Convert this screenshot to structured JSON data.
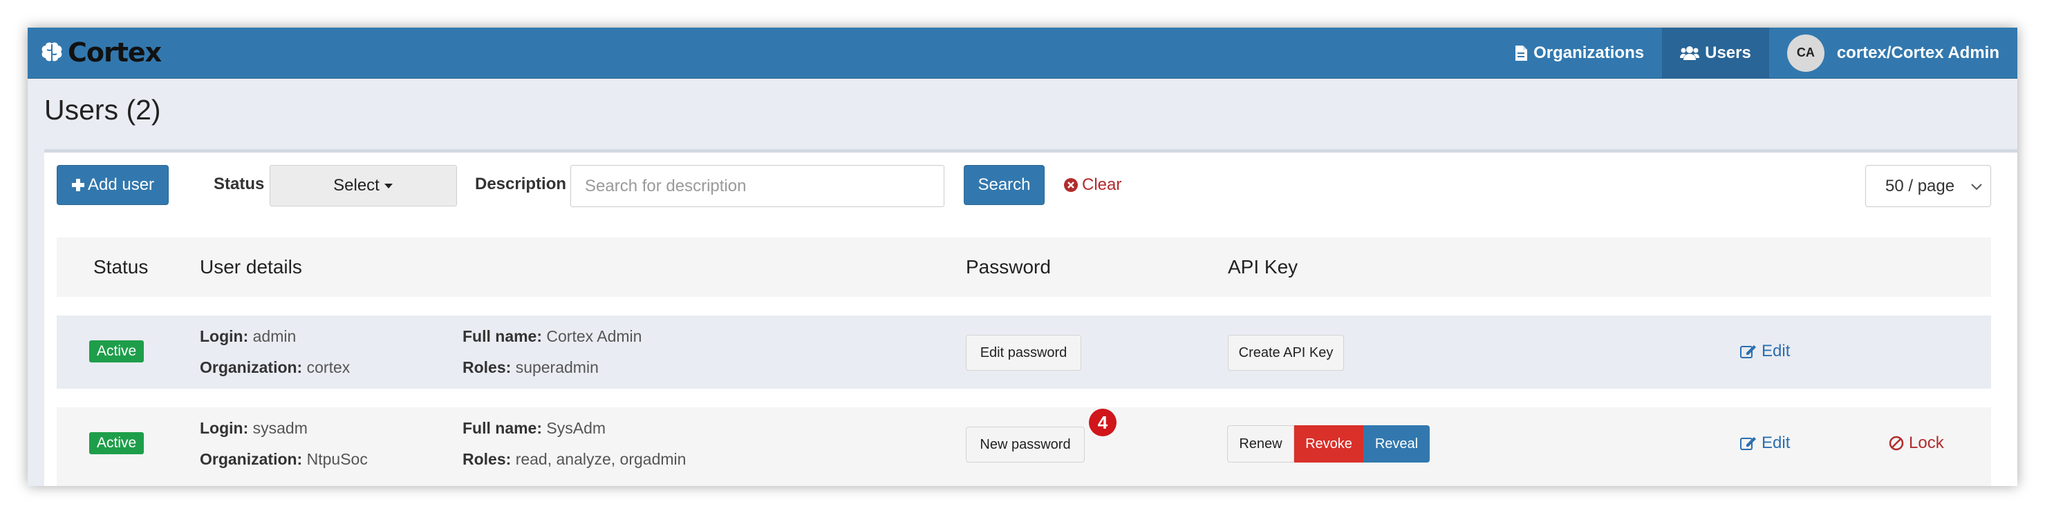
{
  "navbar": {
    "brand": "Cortex",
    "items": [
      {
        "label": "Organizations",
        "icon": "document-icon"
      },
      {
        "label": "Users",
        "icon": "users-icon",
        "active": true
      }
    ],
    "user": {
      "initials": "CA",
      "label": "cortex/Cortex Admin"
    }
  },
  "page": {
    "title": "Users (2)"
  },
  "toolbar": {
    "add_user": "Add user",
    "status_label": "Status",
    "status_value": "Select",
    "description_label": "Description",
    "description_placeholder": "Search for description",
    "search": "Search",
    "clear": "Clear",
    "per_page": "50 / page"
  },
  "table": {
    "headers": {
      "status": "Status",
      "user_details": "User details",
      "password": "Password",
      "api_key": "API Key"
    },
    "rows": [
      {
        "status": "Active",
        "login_label": "Login:",
        "login": "admin",
        "org_label": "Organization:",
        "org": "cortex",
        "fullname_label": "Full name:",
        "fullname": "Cortex Admin",
        "roles_label": "Roles:",
        "roles": "superadmin",
        "password_action": "Edit password",
        "api_action": "Create API Key",
        "edit": "Edit"
      },
      {
        "status": "Active",
        "login_label": "Login:",
        "login": "sysadm",
        "org_label": "Organization:",
        "org": "NtpuSoc",
        "fullname_label": "Full name:",
        "fullname": "SysAdm",
        "roles_label": "Roles:",
        "roles": "read, analyze, orgadmin",
        "password_action": "New password",
        "password_badge": "4",
        "api_renew": "Renew",
        "api_revoke": "Revoke",
        "api_reveal": "Reveal",
        "edit": "Edit",
        "lock": "Lock"
      }
    ]
  },
  "colors": {
    "primary": "#3278ae",
    "success": "#1e9e4a",
    "danger": "#d9302a",
    "link": "#2c6fb0"
  }
}
